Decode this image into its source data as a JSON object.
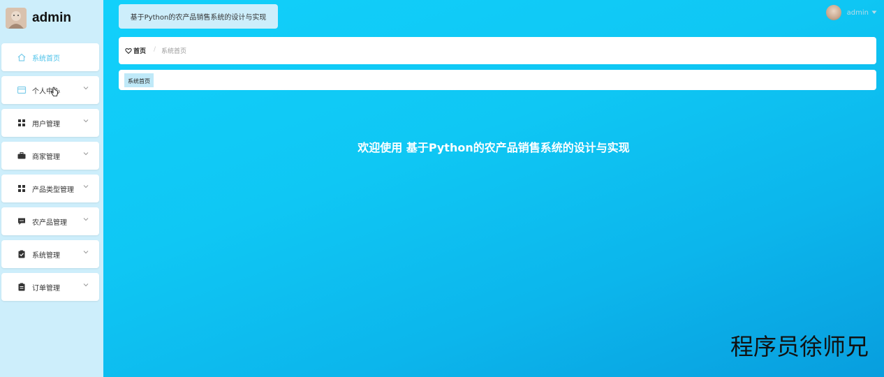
{
  "brand": {
    "title": "admin",
    "avatar_icon": "avatar-icon"
  },
  "sidebar": {
    "items": [
      {
        "label": "系统首页",
        "icon": "home-icon",
        "active": true
      },
      {
        "label": "个人中心",
        "icon": "card-icon",
        "arrow": true
      },
      {
        "label": "用户管理",
        "icon": "grid-icon",
        "arrow": true
      },
      {
        "label": "商家管理",
        "icon": "briefcase-icon",
        "arrow": true
      },
      {
        "label": "产品类型管理",
        "icon": "grid-icon",
        "arrow": true
      },
      {
        "label": "农产品管理",
        "icon": "chat-icon",
        "arrow": true
      },
      {
        "label": "系统管理",
        "icon": "clipboard-check-icon",
        "arrow": true
      },
      {
        "label": "订单管理",
        "icon": "clipboard-icon",
        "arrow": true
      }
    ]
  },
  "header": {
    "title": "基于Python的农产品销售系统的设计与实现",
    "user_name": "admin"
  },
  "breadcrumb": {
    "home": "首页",
    "separator": "/",
    "current": "系统首页"
  },
  "tags": {
    "active": "系统首页"
  },
  "main": {
    "welcome": "欢迎使用 基于Python的农产品销售系统的设计与实现"
  },
  "watermark": "程序员徐师兄",
  "colors": {
    "accent": "#4ec3ea",
    "sidebar_bg": "#cdeefb",
    "main_bg": "#0fc8f5"
  }
}
